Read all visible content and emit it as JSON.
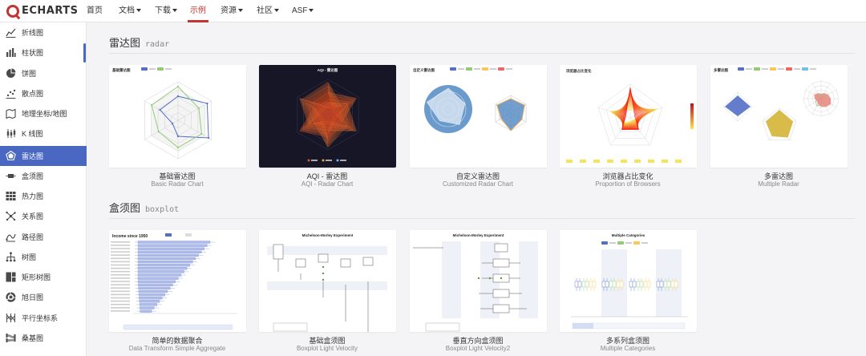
{
  "app": {
    "logo_text": "ECHARTS"
  },
  "nav": [
    {
      "label": "首页",
      "caret": false
    },
    {
      "label": "文档",
      "caret": true
    },
    {
      "label": "下载",
      "caret": true
    },
    {
      "label": "示例",
      "caret": false,
      "active": true
    },
    {
      "label": "资源",
      "caret": true
    },
    {
      "label": "社区",
      "caret": true
    },
    {
      "label": "ASF",
      "caret": true
    }
  ],
  "sidebar": {
    "items": [
      {
        "label": "折线图",
        "icon": "line-chart-icon"
      },
      {
        "label": "柱状图",
        "icon": "bar-chart-icon"
      },
      {
        "label": "饼图",
        "icon": "pie-chart-icon"
      },
      {
        "label": "散点图",
        "icon": "scatter-chart-icon"
      },
      {
        "label": "地理坐标/地图",
        "icon": "map-icon"
      },
      {
        "label": "K 线图",
        "icon": "candlestick-icon"
      },
      {
        "label": "雷达图",
        "icon": "radar-chart-icon",
        "active": true
      },
      {
        "label": "盒须图",
        "icon": "boxplot-icon"
      },
      {
        "label": "热力图",
        "icon": "heatmap-icon"
      },
      {
        "label": "关系图",
        "icon": "graph-icon"
      },
      {
        "label": "路径图",
        "icon": "lines-icon"
      },
      {
        "label": "树图",
        "icon": "tree-icon"
      },
      {
        "label": "矩形树图",
        "icon": "treemap-icon"
      },
      {
        "label": "旭日图",
        "icon": "sunburst-icon"
      },
      {
        "label": "平行坐标系",
        "icon": "parallel-icon"
      },
      {
        "label": "桑基图",
        "icon": "sankey-icon"
      }
    ]
  },
  "sections": [
    {
      "title": "雷达图",
      "subtitle": "radar",
      "cards": [
        {
          "title": "基础雷达图",
          "subtitle": "Basic Radar Chart",
          "thumb": "radar-basic"
        },
        {
          "title": "AQI - 雷达图",
          "subtitle": "AQI - Radar Chart",
          "thumb": "radar-aqi"
        },
        {
          "title": "自定义雷达图",
          "subtitle": "Customized Radar Chart",
          "thumb": "radar-custom"
        },
        {
          "title": "浏览器占比变化",
          "subtitle": "Proportion of Browsers",
          "thumb": "radar-browsers"
        },
        {
          "title": "多雷达图",
          "subtitle": "Multiple Radar",
          "thumb": "radar-multiple"
        }
      ]
    },
    {
      "title": "盒须图",
      "subtitle": "boxplot",
      "cards": [
        {
          "title": "简单的数据聚合",
          "subtitle": "Data Transform Simple Aggregate",
          "thumb": "box-aggregate",
          "chart_title": "Income since 1950"
        },
        {
          "title": "基础盒须图",
          "subtitle": "Boxplot Light Velocity",
          "thumb": "box-light",
          "chart_title": "Michelson-Morley Experiment"
        },
        {
          "title": "垂直方向盒须图",
          "subtitle": "Boxplot Light Velocity2",
          "thumb": "box-light2",
          "chart_title": "Michelson-Morley Experiment"
        },
        {
          "title": "多系列盒须图",
          "subtitle": "Multiple Categories",
          "thumb": "box-multi",
          "chart_title": "Multiple Categories"
        }
      ]
    }
  ],
  "thumb_text": {
    "radar_basic_title": "基础雷达图",
    "radar_aqi_title": "AQI - 雷达图",
    "radar_custom_title": "自定义雷达图",
    "radar_browsers_title": "浏览器占比变化",
    "radar_multiple_title": "多雷达图"
  },
  "colors": {
    "accent_red": "#c23531",
    "active_blue": "#4a67c2",
    "echarts_blue": "#5470c6",
    "echarts_green": "#91cc75",
    "echarts_yellow": "#fac858",
    "echarts_red": "#ee6666"
  }
}
